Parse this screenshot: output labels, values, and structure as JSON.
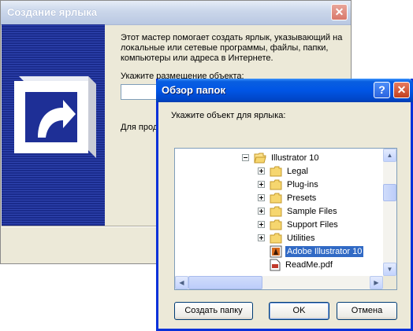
{
  "wizard": {
    "title": "Создание ярлыка",
    "description": "Этот мастер помогает создать ярлык, указывающий на локальные или сетевые программы, файлы, папки, компьютеры или адреса в Интернете.",
    "location_label": "Укажите размещение объекта:",
    "location_value": "",
    "partial_text": "Для прод"
  },
  "dialog": {
    "title": "Обзор папок",
    "instruction": "Укажите объект для ярлыка:",
    "tree": [
      {
        "label": "Illustrator 10",
        "type": "folder-open",
        "expander": "minus",
        "level": 0,
        "selected": false
      },
      {
        "label": "Legal",
        "type": "folder",
        "expander": "plus",
        "level": 1,
        "selected": false
      },
      {
        "label": "Plug-ins",
        "type": "folder",
        "expander": "plus",
        "level": 1,
        "selected": false
      },
      {
        "label": "Presets",
        "type": "folder",
        "expander": "plus",
        "level": 1,
        "selected": false
      },
      {
        "label": "Sample Files",
        "type": "folder",
        "expander": "plus",
        "level": 1,
        "selected": false
      },
      {
        "label": "Support Files",
        "type": "folder",
        "expander": "plus",
        "level": 1,
        "selected": false
      },
      {
        "label": "Utilities",
        "type": "folder",
        "expander": "plus",
        "level": 1,
        "selected": false
      },
      {
        "label": "Adobe Illustrator 10",
        "type": "app",
        "expander": "none",
        "level": 1,
        "selected": true
      },
      {
        "label": "ReadMe.pdf",
        "type": "pdf",
        "expander": "none",
        "level": 1,
        "selected": false
      }
    ],
    "buttons": {
      "new_folder": "Создать папку",
      "ok": "OK",
      "cancel": "Отмена"
    }
  },
  "colors": {
    "selection": "#316ac5",
    "titlebar_active": "#0055e5",
    "dialog_bg": "#ece9d8"
  }
}
